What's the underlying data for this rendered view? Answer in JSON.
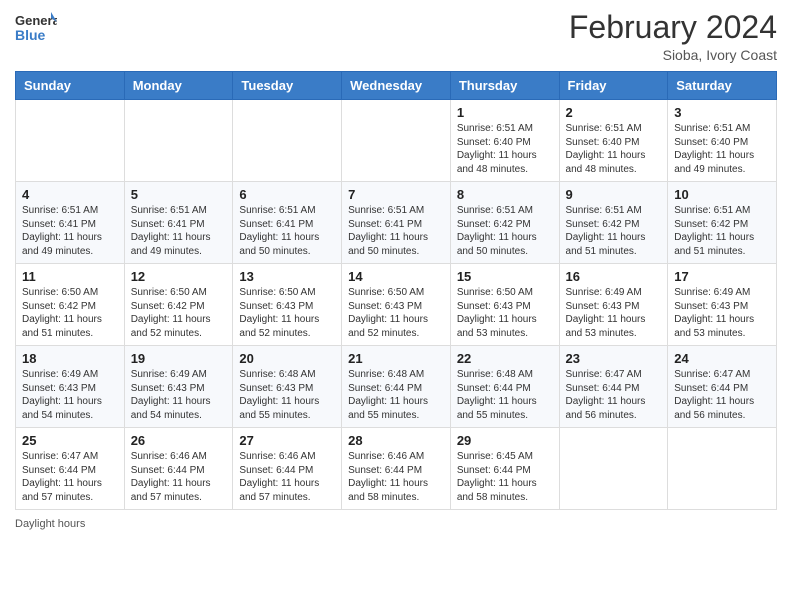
{
  "header": {
    "logo_line1": "General",
    "logo_line2": "Blue",
    "main_title": "February 2024",
    "subtitle": "Sioba, Ivory Coast"
  },
  "days_of_week": [
    "Sunday",
    "Monday",
    "Tuesday",
    "Wednesday",
    "Thursday",
    "Friday",
    "Saturday"
  ],
  "weeks": [
    [
      {
        "day": "",
        "info": ""
      },
      {
        "day": "",
        "info": ""
      },
      {
        "day": "",
        "info": ""
      },
      {
        "day": "",
        "info": ""
      },
      {
        "day": "1",
        "info": "Sunrise: 6:51 AM\nSunset: 6:40 PM\nDaylight: 11 hours and 48 minutes."
      },
      {
        "day": "2",
        "info": "Sunrise: 6:51 AM\nSunset: 6:40 PM\nDaylight: 11 hours and 48 minutes."
      },
      {
        "day": "3",
        "info": "Sunrise: 6:51 AM\nSunset: 6:40 PM\nDaylight: 11 hours and 49 minutes."
      }
    ],
    [
      {
        "day": "4",
        "info": "Sunrise: 6:51 AM\nSunset: 6:41 PM\nDaylight: 11 hours and 49 minutes."
      },
      {
        "day": "5",
        "info": "Sunrise: 6:51 AM\nSunset: 6:41 PM\nDaylight: 11 hours and 49 minutes."
      },
      {
        "day": "6",
        "info": "Sunrise: 6:51 AM\nSunset: 6:41 PM\nDaylight: 11 hours and 50 minutes."
      },
      {
        "day": "7",
        "info": "Sunrise: 6:51 AM\nSunset: 6:41 PM\nDaylight: 11 hours and 50 minutes."
      },
      {
        "day": "8",
        "info": "Sunrise: 6:51 AM\nSunset: 6:42 PM\nDaylight: 11 hours and 50 minutes."
      },
      {
        "day": "9",
        "info": "Sunrise: 6:51 AM\nSunset: 6:42 PM\nDaylight: 11 hours and 51 minutes."
      },
      {
        "day": "10",
        "info": "Sunrise: 6:51 AM\nSunset: 6:42 PM\nDaylight: 11 hours and 51 minutes."
      }
    ],
    [
      {
        "day": "11",
        "info": "Sunrise: 6:50 AM\nSunset: 6:42 PM\nDaylight: 11 hours and 51 minutes."
      },
      {
        "day": "12",
        "info": "Sunrise: 6:50 AM\nSunset: 6:42 PM\nDaylight: 11 hours and 52 minutes."
      },
      {
        "day": "13",
        "info": "Sunrise: 6:50 AM\nSunset: 6:43 PM\nDaylight: 11 hours and 52 minutes."
      },
      {
        "day": "14",
        "info": "Sunrise: 6:50 AM\nSunset: 6:43 PM\nDaylight: 11 hours and 52 minutes."
      },
      {
        "day": "15",
        "info": "Sunrise: 6:50 AM\nSunset: 6:43 PM\nDaylight: 11 hours and 53 minutes."
      },
      {
        "day": "16",
        "info": "Sunrise: 6:49 AM\nSunset: 6:43 PM\nDaylight: 11 hours and 53 minutes."
      },
      {
        "day": "17",
        "info": "Sunrise: 6:49 AM\nSunset: 6:43 PM\nDaylight: 11 hours and 53 minutes."
      }
    ],
    [
      {
        "day": "18",
        "info": "Sunrise: 6:49 AM\nSunset: 6:43 PM\nDaylight: 11 hours and 54 minutes."
      },
      {
        "day": "19",
        "info": "Sunrise: 6:49 AM\nSunset: 6:43 PM\nDaylight: 11 hours and 54 minutes."
      },
      {
        "day": "20",
        "info": "Sunrise: 6:48 AM\nSunset: 6:43 PM\nDaylight: 11 hours and 55 minutes."
      },
      {
        "day": "21",
        "info": "Sunrise: 6:48 AM\nSunset: 6:44 PM\nDaylight: 11 hours and 55 minutes."
      },
      {
        "day": "22",
        "info": "Sunrise: 6:48 AM\nSunset: 6:44 PM\nDaylight: 11 hours and 55 minutes."
      },
      {
        "day": "23",
        "info": "Sunrise: 6:47 AM\nSunset: 6:44 PM\nDaylight: 11 hours and 56 minutes."
      },
      {
        "day": "24",
        "info": "Sunrise: 6:47 AM\nSunset: 6:44 PM\nDaylight: 11 hours and 56 minutes."
      }
    ],
    [
      {
        "day": "25",
        "info": "Sunrise: 6:47 AM\nSunset: 6:44 PM\nDaylight: 11 hours and 57 minutes."
      },
      {
        "day": "26",
        "info": "Sunrise: 6:46 AM\nSunset: 6:44 PM\nDaylight: 11 hours and 57 minutes."
      },
      {
        "day": "27",
        "info": "Sunrise: 6:46 AM\nSunset: 6:44 PM\nDaylight: 11 hours and 57 minutes."
      },
      {
        "day": "28",
        "info": "Sunrise: 6:46 AM\nSunset: 6:44 PM\nDaylight: 11 hours and 58 minutes."
      },
      {
        "day": "29",
        "info": "Sunrise: 6:45 AM\nSunset: 6:44 PM\nDaylight: 11 hours and 58 minutes."
      },
      {
        "day": "",
        "info": ""
      },
      {
        "day": "",
        "info": ""
      }
    ]
  ],
  "footer": {
    "daylight_label": "Daylight hours"
  }
}
